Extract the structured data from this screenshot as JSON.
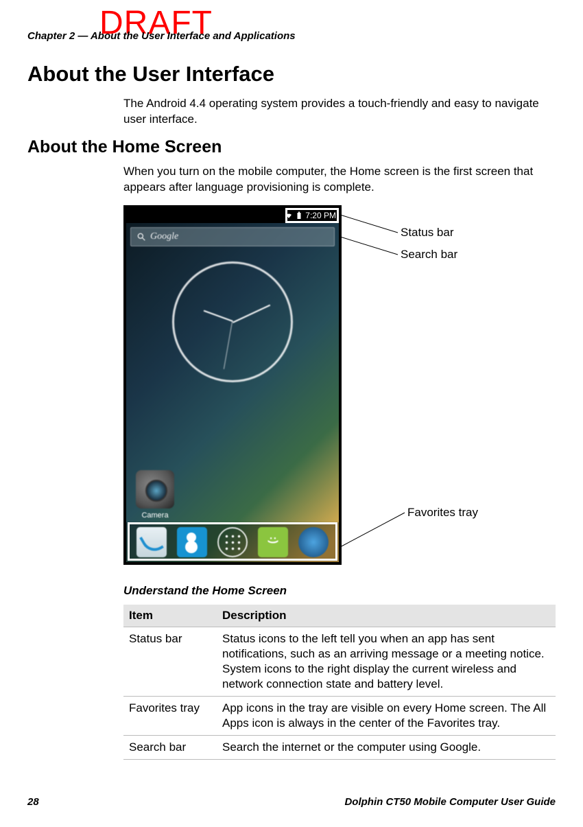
{
  "watermark": "DRAFT",
  "chapter_header": "Chapter 2 — About the User Interface and Applications",
  "h1": "About the User Interface",
  "intro": "The Android 4.4 operating system provides a touch-friendly and easy to navigate user interface.",
  "h2": "About the Home Screen",
  "body2": "When you turn on the mobile computer, the Home screen is the first screen that appears after language provisioning is complete.",
  "screenshot": {
    "time": "7:20 PM",
    "search_placeholder": "Google",
    "camera_label": "Camera"
  },
  "callouts": {
    "status_bar": "Status bar",
    "search_bar": "Search bar",
    "favorites_tray": "Favorites tray"
  },
  "table": {
    "title": "Understand the Home Screen",
    "headers": {
      "item": "Item",
      "description": "Description"
    },
    "rows": [
      {
        "item": "Status bar",
        "desc": "Status icons to the left tell you when an app has sent notifications, such as an arriving message or a meeting notice. System icons to the right display the current wireless and network connection state and battery level."
      },
      {
        "item": "Favorites tray",
        "desc": "App icons in the tray are visible on every Home screen. The All Apps icon is always in the center of the Favorites tray."
      },
      {
        "item": "Search bar",
        "desc": "Search the internet or the computer using Google."
      }
    ]
  },
  "footer": {
    "page": "28",
    "guide": "Dolphin CT50 Mobile Computer User Guide"
  }
}
